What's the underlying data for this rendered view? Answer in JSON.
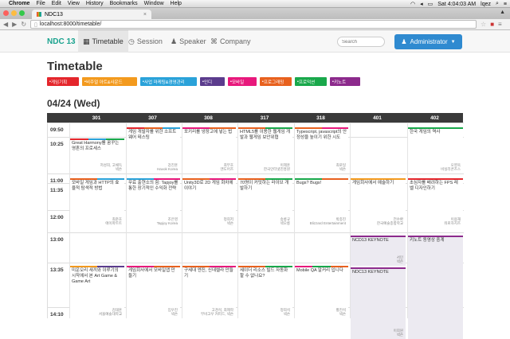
{
  "menubar": {
    "app": "Chrome",
    "items": [
      "File",
      "Edit",
      "View",
      "History",
      "Bookmarks",
      "Window",
      "Help"
    ],
    "time": "Sat 4:04:03 AM",
    "user": "lqez"
  },
  "tab": {
    "title": "NDC13",
    "close": "×"
  },
  "toolbar": {
    "url": "localhost:8000/timetable/"
  },
  "nav": {
    "brand": "NDC 13",
    "items": [
      {
        "label": "Timetable",
        "icon": "calendar-icon"
      },
      {
        "label": "Session",
        "icon": "clock-icon"
      },
      {
        "label": "Speaker",
        "icon": "person-icon"
      },
      {
        "label": "Company",
        "icon": "command-icon"
      }
    ],
    "search_placeholder": "Search",
    "admin": "Administrator"
  },
  "page": {
    "title": "Timetable",
    "date": "04/24 (Wed)"
  },
  "categories": [
    {
      "label": "게임기획",
      "color": "#e4262c",
      "icon": "grid-icon"
    },
    {
      "label": "비주얼 아트&사운드",
      "color": "#f39a1e",
      "icon": "music-icon"
    },
    {
      "label": "사업 마케팅&경영관리",
      "color": "#2aa2d9",
      "icon": "chart-icon"
    },
    {
      "label": "인디",
      "color": "#5b3c8d",
      "icon": "flask-icon"
    },
    {
      "label": "모바일",
      "color": "#e8197c",
      "icon": "mobile-icon"
    },
    {
      "label": "프로그래밍",
      "color": "#e8611e",
      "icon": "code-icon"
    },
    {
      "label": "프로덕션",
      "color": "#19a84b",
      "icon": "sitemap-icon"
    },
    {
      "label": "키노트",
      "color": "#8c2a8c",
      "icon": "keynote-icon"
    }
  ],
  "rooms": [
    "301",
    "307",
    "308",
    "317",
    "318",
    "401",
    "402"
  ],
  "times": [
    "09:50",
    "10:25",
    "11:00",
    "11:35",
    "12:00",
    "13:00",
    "13:35",
    "14:10"
  ],
  "sessions": [
    {
      "title": "Great Harmony를 꿈꾸는 영혼의 프로세스",
      "speaker": "저성희, 고채득",
      "company": "넥슨"
    },
    {
      "title": "게임 개발자를 위한 소프트웨어 테스팅",
      "speaker": "강진훈",
      "company": "Havok Korea"
    },
    {
      "title": "포키리를 냉장고에 넣는 법",
      "speaker": "최무호",
      "company": "엔도어즈"
    },
    {
      "title": "HTML5를 이용한 웹게임 개발과 웹게임 보안위협",
      "speaker": "이제훈",
      "company": "한국인터넷진흥원"
    },
    {
      "title": "Typescript, javascript의 안정성을 높이기 위한 시도",
      "speaker": "최로일",
      "company": "넥슨"
    },
    {
      "title": "한국 게임의 역사",
      "speaker": "오영욱",
      "company": "비실리콘즈스"
    },
    {
      "title": "모바일 게임과 HTTP의 효율적 탐색적 방법",
      "speaker": "최준호",
      "company": "에이파트트"
    },
    {
      "title": "무료 출현소의 힘: Tapjoy를 통한 장기적인 수익화 전략",
      "speaker": "조은영",
      "company": "Tapjoy Korea"
    },
    {
      "title": "Unity3D로 2D 게임 화차에 이야기",
      "speaker": "정희저",
      "company": "넥슨"
    },
    {
      "title": "70명이 커밋하는 라이브 개발하기",
      "speaker": "송롱규",
      "company": "넥오롱"
    },
    {
      "title": "Bugs? Bugs!",
      "speaker": "박종진",
      "company": "Blizzard Entertainment"
    },
    {
      "title": "게임회사에서 예술하기",
      "speaker": "전수환",
      "company": "한국예술종합학교"
    },
    {
      "title": "초심자를 배려하는 FPS 레벨 디자인하기",
      "speaker": "이용재",
      "company": "워로자지즈"
    },
    {
      "title": "NCD13 KEYNOTE",
      "speaker": "서민",
      "company": "넥슨"
    },
    {
      "title": "키노트 동영상 중계",
      "speaker": "",
      "company": ""
    },
    {
      "title": "NDC13 KEYNOTE",
      "speaker": "이희원",
      "company": "넥슨"
    },
    {
      "title": "미운오리 새끼와 이루기의 시작에서 본 Art Game & Game Art",
      "speaker": "김태훈",
      "company": "서울예술대학교"
    },
    {
      "title": "게임회사에서 모바일앱 만들기",
      "speaker": "임우진",
      "company": "넥슨"
    },
    {
      "title": "구세대 엔진, 신데렐라 만들기",
      "speaker": "고경석, 최제학",
      "company": "부비고우 커피드, 넥슨"
    },
    {
      "title": "세이더 리소스 빌드 자동화 할 수 없나요?",
      "speaker": "정희석",
      "company": "넥슨"
    },
    {
      "title": "Mobile QA 알커리 입니다",
      "speaker": "황진석",
      "company": "넥슨"
    }
  ]
}
